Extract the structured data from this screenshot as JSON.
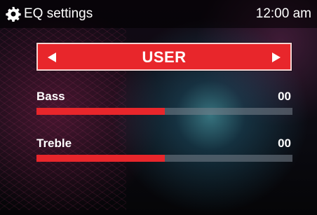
{
  "header": {
    "icon": "gear-icon",
    "title": "EQ settings",
    "time": "12:00 am"
  },
  "preset": {
    "label": "USER",
    "prev_icon": "triangle-left-icon",
    "next_icon": "triangle-right-icon"
  },
  "eq": [
    {
      "label": "Bass",
      "value": "00",
      "level": 0.5
    },
    {
      "label": "Treble",
      "value": "00",
      "level": 0.5
    }
  ],
  "colors": {
    "accent": "#e8262b",
    "track": "#6b747c",
    "text": "#ffffff"
  }
}
